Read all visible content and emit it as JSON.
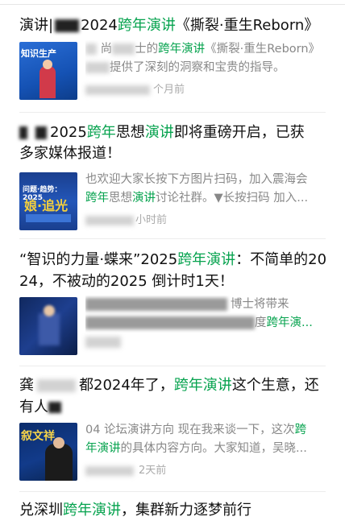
{
  "colors": {
    "highlight": "#07a34f",
    "title": "#111111",
    "snippet": "#888888",
    "meta": "#aaaaaa"
  },
  "items": [
    {
      "title": {
        "a": "演讲|",
        "b": "2024",
        "c": "跨年演讲",
        "d": "《撕裂·重生Reborn》"
      },
      "snippet1": {
        "a": "尚",
        "b": "士的",
        "c": "跨年演讲",
        "d": "《撕裂·重生Reborn》"
      },
      "snippet2": {
        "a": "提供了深刻的洞察和宝贵的指导。"
      },
      "meta": "个月前",
      "thumb_text": "知识生产"
    },
    {
      "title1": {
        "a": "2025",
        "b": "跨年",
        "c": "思想",
        "d": "演讲",
        "e": "即将重磅开启，已获"
      },
      "title2": {
        "a": "多家媒体报道！"
      },
      "snippet1": {
        "a": "也欢迎大家长按下方图片扫码，加入震海会"
      },
      "snippet2": {
        "a": "跨年",
        "b": "思想",
        "c": "演讲",
        "d": "讨论社群。▼长按扫码 加入..."
      },
      "meta": "小时前",
      "thumb_text": "问题·趋势：2025"
    },
    {
      "title1": {
        "a": "“智识的力量·蝶来”2025",
        "b": "跨年演讲",
        "c": "：不简单的20"
      },
      "title2": {
        "a": "24，不被动的2025 倒计时1天！"
      },
      "snippet1": {
        "a": "博士将带来"
      },
      "snippet2": {
        "a": "度",
        "b": "跨年演..."
      },
      "meta": ""
    },
    {
      "title1": {
        "a": "龚",
        "b": "都2024年了，",
        "c": "跨年演讲",
        "d": "这个生意，还"
      },
      "title2": {
        "a": "有人",
        "b": ""
      },
      "snippet1": {
        "a": "04 论坛演讲方向 现在我来谈一下，这次",
        "b": "跨"
      },
      "snippet2": {
        "a": "年演讲",
        "b": "的具体内容方向。大家知道，吴晓..."
      },
      "meta": "2天前",
      "thumb_text": "叙文祥"
    },
    {
      "title1": {
        "a": "兑深圳",
        "b": "跨年演讲",
        "c": "，集群新力逐梦前行"
      }
    }
  ]
}
